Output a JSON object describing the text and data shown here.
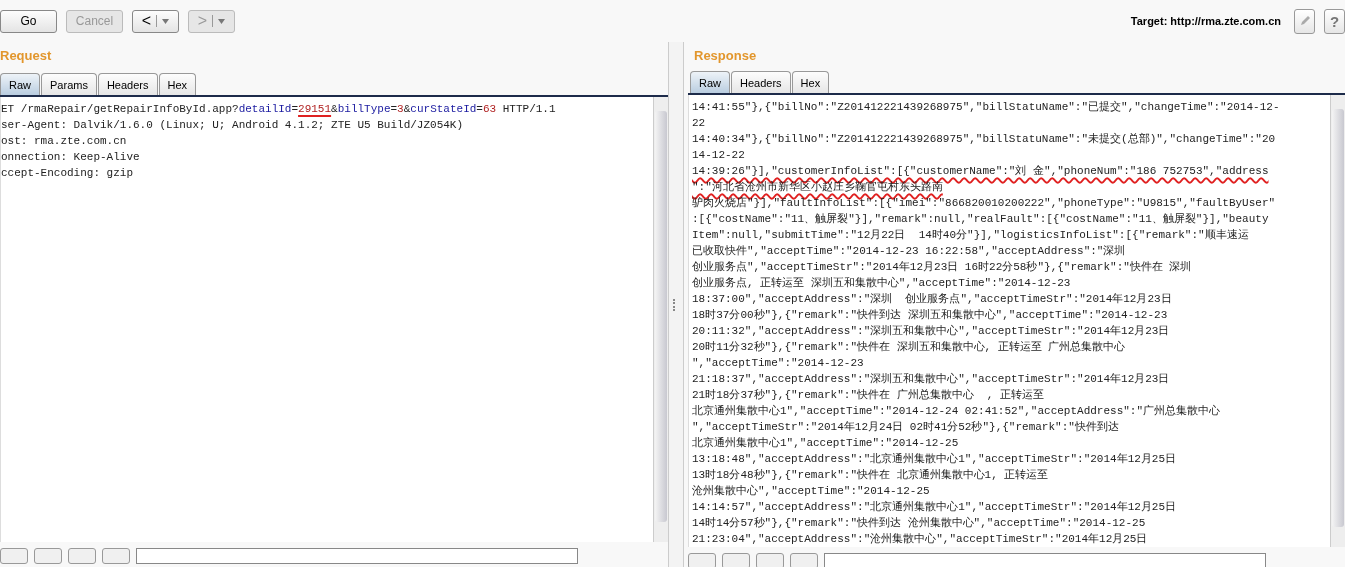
{
  "toolbar": {
    "buttons": [
      {
        "label": "Go",
        "disabled": false
      },
      {
        "label": "Cancel",
        "disabled": true
      }
    ],
    "nav": [
      {
        "label": "<",
        "disabled": false
      },
      {
        "label": ">",
        "disabled": true
      }
    ],
    "target": "Target: http://rma.zte.com.cn",
    "help": "?"
  },
  "request": {
    "title": "Request",
    "tabs": [
      {
        "label": "Raw",
        "selected": true
      },
      {
        "label": "Params",
        "selected": false
      },
      {
        "label": "Headers",
        "selected": false
      },
      {
        "label": "Hex",
        "selected": false
      }
    ],
    "lines": [
      [
        {
          "kind": "text",
          "text": "ET /rmaRepair/getRepairInfoById.app?",
          "underlined": false
        },
        {
          "kind": "param",
          "text": "detailId",
          "underlined": false
        },
        {
          "kind": "text",
          "text": "=",
          "underlined": false
        },
        {
          "kind": "value",
          "text": "29151",
          "underlined": true
        },
        {
          "kind": "text",
          "text": "&",
          "underlined": false
        },
        {
          "kind": "param",
          "text": "billType",
          "underlined": false
        },
        {
          "kind": "text",
          "text": "=",
          "underlined": false
        },
        {
          "kind": "value",
          "text": "3",
          "underlined": false
        },
        {
          "kind": "text",
          "text": "&",
          "underlined": false
        },
        {
          "kind": "param",
          "text": "curStateId",
          "underlined": false
        },
        {
          "kind": "text",
          "text": "=",
          "underlined": false
        },
        {
          "kind": "value",
          "text": "63",
          "underlined": false
        },
        {
          "kind": "text",
          "text": " HTTP/1.1",
          "underlined": false
        }
      ],
      [
        {
          "kind": "text",
          "text": "ser-Agent: Dalvik/1.6.0 (Linux; U; Android 4.1.2; ZTE U5 Build/JZ054K)",
          "underlined": false
        }
      ],
      [
        {
          "kind": "text",
          "text": "ost: rma.zte.com.cn",
          "underlined": false
        }
      ],
      [
        {
          "kind": "text",
          "text": "onnection: Keep-Alive",
          "underlined": false
        }
      ],
      [
        {
          "kind": "text",
          "text": "ccept-Encoding: gzip",
          "underlined": false
        }
      ]
    ]
  },
  "response": {
    "title": "Response",
    "tabs": [
      {
        "label": "Raw",
        "selected": true
      },
      {
        "label": "Headers",
        "selected": false
      },
      {
        "label": "Hex",
        "selected": false
      }
    ],
    "lines": [
      {
        "text": "14:41:55\"},{\"billNo\":\"Z201412221439268975\",\"billStatuName\":\"已提交\",\"changeTime\":\"2014-12-",
        "underlined": false
      },
      {
        "text": "22",
        "underlined": false
      },
      {
        "text": "14:40:34\"},{\"billNo\":\"Z201412221439268975\",\"billStatuName\":\"未提交(总部)\",\"changeTime\":\"20",
        "underlined": false
      },
      {
        "text": "14-12-22",
        "underlined": false
      },
      {
        "text": "14:39:26\"}],\"customerInfoList\":[{\"customerName\":\"刘 金\",\"phoneNum\":\"186 752753\",\"address",
        "underlined": true
      },
      {
        "text": "\":\"河北省沧州市新华区小赵庄乡鞠官屯村东头路南",
        "underlined": true
      },
      {
        "text": "驴肉火烧店\"}],\"faultInfoList\":[{\"imei\":\"866820010200222\",\"phoneType\":\"U9815\",\"faultByUser\"",
        "underlined": false
      },
      {
        "text": ":[{\"costName\":\"11、触屏裂\"}],\"remark\":null,\"realFault\":[{\"costName\":\"11、触屏裂\"}],\"beauty",
        "underlined": false
      },
      {
        "text": "Item\":null,\"submitTime\":\"12月22日  14时40分\"}],\"logisticsInfoList\":[{\"remark\":\"顺丰速运",
        "underlined": false
      },
      {
        "text": "已收取快件\",\"acceptTime\":\"2014-12-23 16:22:58\",\"acceptAddress\":\"深圳",
        "underlined": false
      },
      {
        "text": "创业服务点\",\"acceptTimeStr\":\"2014年12月23日 16时22分58秒\"},{\"remark\":\"快件在 深圳",
        "underlined": false
      },
      {
        "text": "创业服务点, 正转运至 深圳五和集散中心\",\"acceptTime\":\"2014-12-23",
        "underlined": false
      },
      {
        "text": "18:37:00\",\"acceptAddress\":\"深圳  创业服务点\",\"acceptTimeStr\":\"2014年12月23日",
        "underlined": false
      },
      {
        "text": "18时37分00秒\"},{\"remark\":\"快件到达 深圳五和集散中心\",\"acceptTime\":\"2014-12-23",
        "underlined": false
      },
      {
        "text": "20:11:32\",\"acceptAddress\":\"深圳五和集散中心\",\"acceptTimeStr\":\"2014年12月23日",
        "underlined": false
      },
      {
        "text": "20时11分32秒\"},{\"remark\":\"快件在 深圳五和集散中心, 正转运至 广州总集散中心",
        "underlined": false
      },
      {
        "text": "\",\"acceptTime\":\"2014-12-23",
        "underlined": false
      },
      {
        "text": "21:18:37\",\"acceptAddress\":\"深圳五和集散中心\",\"acceptTimeStr\":\"2014年12月23日",
        "underlined": false
      },
      {
        "text": "21时18分37秒\"},{\"remark\":\"快件在 广州总集散中心  , 正转运至",
        "underlined": false
      },
      {
        "text": "北京通州集散中心1\",\"acceptTime\":\"2014-12-24 02:41:52\",\"acceptAddress\":\"广州总集散中心",
        "underlined": false
      },
      {
        "text": "\",\"acceptTimeStr\":\"2014年12月24日 02时41分52秒\"},{\"remark\":\"快件到达",
        "underlined": false
      },
      {
        "text": "北京通州集散中心1\",\"acceptTime\":\"2014-12-25",
        "underlined": false
      },
      {
        "text": "13:18:48\",\"acceptAddress\":\"北京通州集散中心1\",\"acceptTimeStr\":\"2014年12月25日",
        "underlined": false
      },
      {
        "text": "13时18分48秒\"},{\"remark\":\"快件在 北京通州集散中心1, 正转运至",
        "underlined": false
      },
      {
        "text": "沧州集散中心\",\"acceptTime\":\"2014-12-25",
        "underlined": false
      },
      {
        "text": "14:14:57\",\"acceptAddress\":\"北京通州集散中心1\",\"acceptTimeStr\":\"2014年12月25日",
        "underlined": false
      },
      {
        "text": "14时14分57秒\"},{\"remark\":\"快件到达 沧州集散中心\",\"acceptTime\":\"2014-12-25",
        "underlined": false
      },
      {
        "text": "21:23:04\",\"acceptAddress\":\"沧州集散中心\",\"acceptTimeStr\":\"2014年12月25日",
        "underlined": false
      }
    ]
  }
}
